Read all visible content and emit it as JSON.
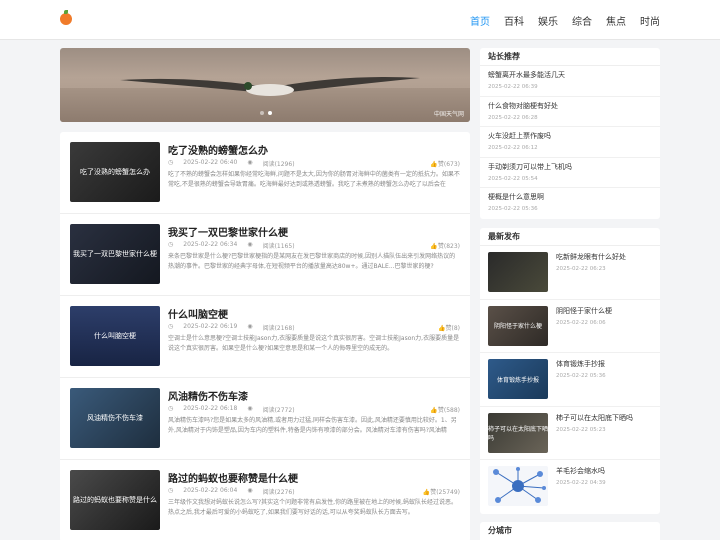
{
  "nav": [
    "首页",
    "百科",
    "娱乐",
    "综合",
    "焦点",
    "时尚"
  ],
  "banner": {
    "watermark": "中国天气网"
  },
  "articles": [
    {
      "title": "吃了没熟的螃蟹怎么办",
      "thumb_text": "吃了没熟的螃蟹怎么办",
      "date": "2025-02-22 06:40",
      "views": "阅读(1296)",
      "likes": "赞(673)",
      "summary": "吃了不熟的螃蟹会怎样如果你经常吃海鲜,问题不是太大,因为你的肠胃对海鲜中的菌类有一定的抵抗力。如果不常吃,不是很熟的螃蟹会导致胃痛。吃海鲜最好达到或熟透螃蟹。我吃了未煮熟的螃蟹怎么办吃了以后会在"
    },
    {
      "title": "我买了一双巴黎世家什么梗",
      "thumb_text": "我买了一双巴黎世家什么梗",
      "date": "2025-02-22 06:34",
      "views": "阅读(1165)",
      "likes": "赞(823)",
      "summary": "来条巴黎世家是什么梗?巴黎世家梗指的是某网友在发巴黎世家商店的时候,因别人描队伍出来引发网络热议的热潮的事件。巴黎世家的经典字母体,在短视频平台的播放量高达80w+。通过BALE...巴黎世家的梗?"
    },
    {
      "title": "什么叫脑空梗",
      "thumb_text": "什么叫脑空梗",
      "date": "2025-02-22 06:19",
      "views": "阅读(2168)",
      "likes": "赞(8)",
      "summary": "空调士是什么意思梗?空调士技能Jason力,衣服要质量是说这个真实很厉害。空调士技能Jason力,衣服要质量是说这个真实很厉害。如果空是什么梗?如果空意思是和某一个人的侮辱里空的成无的。"
    },
    {
      "title": "风油精伤不伤车漆",
      "thumb_text": "风油精伤不伤车漆",
      "date": "2025-02-22 06:18",
      "views": "阅读(2772)",
      "likes": "赞(588)",
      "summary": "风油精伤车漆吗?您是如果太多的风油精,或者用力过猛,同样会伤害车漆。因此,风油精还要慎用比较好。1、另外,风油精对于内饰是塑品,因为车内的塑料件,特备是内饰有喷漆的部分会。风油精对车漆有伤害吗?风油精"
    },
    {
      "title": "路过的蚂蚁也要称赞是什么梗",
      "thumb_text": "路过的蚂蚁也要称赞是什么",
      "date": "2025-02-22 06:04",
      "views": "阅读(2276)",
      "likes": "赞(25749)",
      "summary": "三年级作文我想对蚂蚁长说怎么写?其实这个问题非常有启发性,你的路里被在地上的时候,蚂蚁队长经过说恶。热点之后,我才最后可爱的小蚂蚁吃了,如果我们要写好话的话,可以从夸奖蚂蚁队长方面去写。"
    }
  ],
  "sidebar": {
    "rec_title": "站长推荐",
    "rec_items": [
      {
        "title": "螃蟹离开水最多能活几天",
        "date": "2025-02-22 06:39"
      },
      {
        "title": "什么食物对脑梗有好处",
        "date": "2025-02-22 06:28"
      },
      {
        "title": "火车没赶上票作废吗",
        "date": "2025-02-22 06:12"
      },
      {
        "title": "手动剃须刀可以带上飞机吗",
        "date": "2025-02-22 05:54"
      },
      {
        "title": "梗概是什么意思啊",
        "date": "2025-02-22 05:36"
      }
    ],
    "new_title": "最新发布",
    "new_items": [
      {
        "title": "吃新鲜龙眼有什么好处",
        "date": "2025-02-22 06:23",
        "thumb_text": ""
      },
      {
        "title": "阴阳怪于家什么梗",
        "date": "2025-02-22 06:06",
        "thumb_text": "阴阳怪于家什么梗"
      },
      {
        "title": "体育锻炼手抄报",
        "date": "2025-02-22 05:36",
        "thumb_text": "体育锻炼手抄报"
      },
      {
        "title": "柿子可以在太阳底下晒吗",
        "date": "2025-02-22 05:23",
        "thumb_text": "柿子可以在太阳底下晒吗"
      },
      {
        "title": "羊毛衫会缩水吗",
        "date": "2025-02-22 04:39",
        "thumb_text": ""
      }
    ],
    "city_title": "分城市"
  }
}
